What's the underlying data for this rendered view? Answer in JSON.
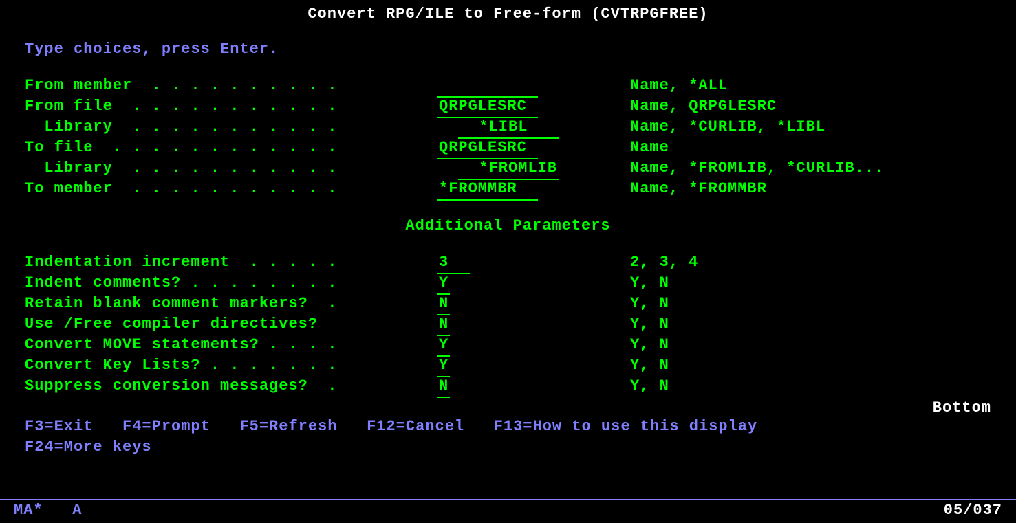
{
  "title": "Convert RPG/ILE to Free-form (CVTRPGFREE)",
  "instruction": "Type choices, press Enter.",
  "fields": {
    "from_member": {
      "label": "From member  . . . . . . . . . .",
      "value": "          ",
      "hint": "Name, *ALL"
    },
    "from_file": {
      "label": "From file  . . . . . . . . . . .",
      "value": "QRPGLESRC ",
      "hint": "Name, QRPGLESRC"
    },
    "from_lib": {
      "label": "  Library  . . . . . . . . . . .",
      "value": "  *LIBL   ",
      "hint": "Name, *CURLIB, *LIBL"
    },
    "to_file": {
      "label": "To file  . . . . . . . . . . . .",
      "value": "QRPGLESRC ",
      "hint": "Name"
    },
    "to_lib": {
      "label": "  Library  . . . . . . . . . . .",
      "value": "  *FROMLIB",
      "hint": "Name, *FROMLIB, *CURLIB..."
    },
    "to_member": {
      "label": "To member  . . . . . . . . . . .",
      "value": "*FROMMBR  ",
      "hint": "Name, *FROMMBR"
    }
  },
  "section_header": "Additional Parameters",
  "params": {
    "indent_inc": {
      "label": "Indentation increment  . . . . .",
      "value": "3  ",
      "hint": "2, 3, 4"
    },
    "indent_cmt": {
      "label": "Indent comments? . . . . . . . .",
      "value": "Y",
      "hint": "Y, N"
    },
    "retain_blank": {
      "label": "Retain blank comment markers?  .",
      "value": "N",
      "hint": "Y, N"
    },
    "use_free": {
      "label": "Use /Free compiler directives?  ",
      "value": "N",
      "hint": "Y, N"
    },
    "conv_move": {
      "label": "Convert MOVE statements? . . . .",
      "value": "Y",
      "hint": "Y, N"
    },
    "conv_klist": {
      "label": "Convert Key Lists? . . . . . . .",
      "value": "Y",
      "hint": "Y, N"
    },
    "suppress": {
      "label": "Suppress conversion messages?  .",
      "value": "N",
      "hint": "Y, N"
    }
  },
  "scroll_indicator": "Bottom",
  "fkeys_line1": "F3=Exit   F4=Prompt   F5=Refresh   F12=Cancel   F13=How to use this display",
  "fkeys_line2": "F24=More keys",
  "status": {
    "left": "MA*   A",
    "right": "05/037"
  }
}
